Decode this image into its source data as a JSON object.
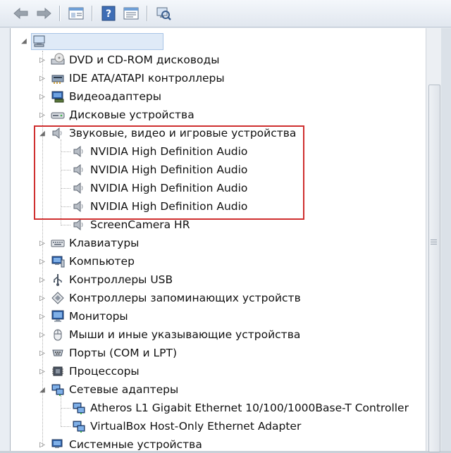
{
  "toolbar": {
    "buttons": [
      {
        "name": "back-button",
        "icon": "arrow-left-icon"
      },
      {
        "name": "forward-button",
        "icon": "arrow-right-icon"
      },
      {
        "name": "show-hide-console-tree-button",
        "icon": "console-tree-icon"
      },
      {
        "name": "help-button",
        "icon": "help-icon"
      },
      {
        "name": "properties-button",
        "icon": "properties-icon"
      },
      {
        "name": "scan-hardware-button",
        "icon": "scan-hardware-icon"
      }
    ]
  },
  "tree": {
    "root": {
      "label": "",
      "icon": "computer-icon"
    },
    "categories": [
      {
        "label": "DVD и CD-ROM дисководы",
        "icon": "dvd-drive-icon",
        "expanded": false
      },
      {
        "label": "IDE ATA/ATAPI контроллеры",
        "icon": "ide-controller-icon",
        "expanded": false
      },
      {
        "label": "Видеоадаптеры",
        "icon": "display-adapter-icon",
        "expanded": false
      },
      {
        "label": "Дисковые устройства",
        "icon": "disk-drive-icon",
        "expanded": false
      },
      {
        "label": "Звуковые, видео и игровые устройства",
        "icon": "speaker-icon",
        "expanded": true,
        "children": [
          {
            "label": "NVIDIA High Definition Audio",
            "icon": "speaker-icon"
          },
          {
            "label": "NVIDIA High Definition Audio",
            "icon": "speaker-icon"
          },
          {
            "label": "NVIDIA High Definition Audio",
            "icon": "speaker-icon"
          },
          {
            "label": "NVIDIA High Definition Audio",
            "icon": "speaker-icon"
          },
          {
            "label": "ScreenCamera HR",
            "icon": "speaker-icon"
          }
        ]
      },
      {
        "label": "Клавиатуры",
        "icon": "keyboard-icon",
        "expanded": false
      },
      {
        "label": "Компьютер",
        "icon": "computer-icon",
        "expanded": false
      },
      {
        "label": "Контроллеры USB",
        "icon": "usb-icon",
        "expanded": false
      },
      {
        "label": "Контроллеры запоминающих устройств",
        "icon": "storage-controller-icon",
        "expanded": false
      },
      {
        "label": "Мониторы",
        "icon": "monitor-icon",
        "expanded": false
      },
      {
        "label": "Мыши и иные указывающие устройства",
        "icon": "mouse-icon",
        "expanded": false
      },
      {
        "label": "Порты (COM и LPT)",
        "icon": "port-icon",
        "expanded": false
      },
      {
        "label": "Процессоры",
        "icon": "processor-icon",
        "expanded": false
      },
      {
        "label": "Сетевые адаптеры",
        "icon": "network-adapter-icon",
        "expanded": true,
        "children": [
          {
            "label": "Atheros L1 Gigabit Ethernet 10/100/1000Base-T Controller",
            "icon": "network-adapter-icon"
          },
          {
            "label": "VirtualBox Host-Only Ethernet Adapter",
            "icon": "network-adapter-icon"
          }
        ]
      },
      {
        "label": "Системные устройства",
        "icon": "system-device-icon",
        "expanded": false
      }
    ]
  },
  "highlight_color": "#cf2f2f"
}
